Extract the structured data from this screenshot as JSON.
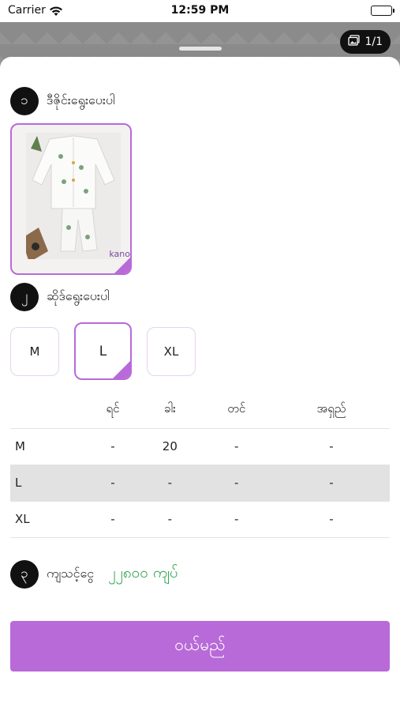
{
  "status_bar": {
    "carrier": "Carrier",
    "time": "12:59 PM"
  },
  "photo_counter": "1/1",
  "steps": [
    {
      "num": "၁",
      "label": "ဒီဇိုင်းရွေးပေးပါ"
    },
    {
      "num": "၂",
      "label": "ဆိုဒ်ရွေးပေးပါ"
    },
    {
      "num": "၃",
      "label": "ကျသင့်ငွေ"
    }
  ],
  "variant": {
    "brand_text": "kano"
  },
  "sizes": [
    {
      "label": "M",
      "selected": false
    },
    {
      "label": "L",
      "selected": true
    },
    {
      "label": "XL",
      "selected": false
    }
  ],
  "table": {
    "headers": [
      "",
      "ရင်",
      "ခါး",
      "တင်",
      "အရှည်"
    ],
    "rows": [
      [
        "M",
        "-",
        "20",
        "-",
        "-"
      ],
      [
        "L",
        "-",
        "-",
        "-",
        "-"
      ],
      [
        "XL",
        "-",
        "-",
        "-",
        "-"
      ]
    ],
    "highlighted_row": 1
  },
  "price": "၂၂၈၀၀ ကျပ်",
  "buy_button": "ဝယ်မည်",
  "colors": {
    "accent": "#b86ad8",
    "price": "#2aa24a"
  }
}
